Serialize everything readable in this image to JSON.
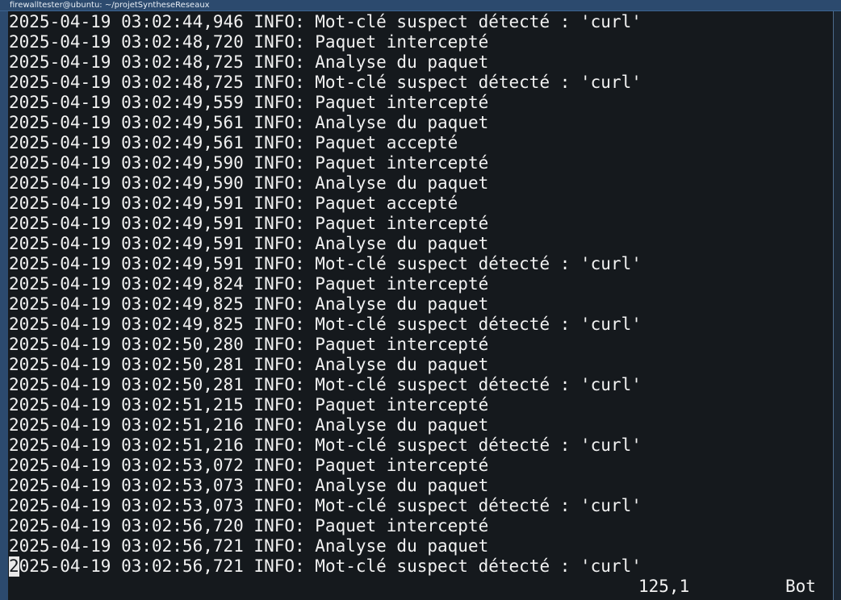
{
  "window": {
    "title": "firewalltester@ubuntu: ~/projetSyntheseReseaux"
  },
  "terminal": {
    "lines": [
      "2025-04-19 03:02:44,946 INFO: Mot-clé suspect détecté : 'curl'",
      "2025-04-19 03:02:48,720 INFO: Paquet intercepté",
      "2025-04-19 03:02:48,725 INFO: Analyse du paquet",
      "2025-04-19 03:02:48,725 INFO: Mot-clé suspect détecté : 'curl'",
      "2025-04-19 03:02:49,559 INFO: Paquet intercepté",
      "2025-04-19 03:02:49,561 INFO: Analyse du paquet",
      "2025-04-19 03:02:49,561 INFO: Paquet accepté",
      "2025-04-19 03:02:49,590 INFO: Paquet intercepté",
      "2025-04-19 03:02:49,590 INFO: Analyse du paquet",
      "2025-04-19 03:02:49,591 INFO: Paquet accepté",
      "2025-04-19 03:02:49,591 INFO: Paquet intercepté",
      "2025-04-19 03:02:49,591 INFO: Analyse du paquet",
      "2025-04-19 03:02:49,591 INFO: Mot-clé suspect détecté : 'curl'",
      "2025-04-19 03:02:49,824 INFO: Paquet intercepté",
      "2025-04-19 03:02:49,825 INFO: Analyse du paquet",
      "2025-04-19 03:02:49,825 INFO: Mot-clé suspect détecté : 'curl'",
      "2025-04-19 03:02:50,280 INFO: Paquet intercepté",
      "2025-04-19 03:02:50,281 INFO: Analyse du paquet",
      "2025-04-19 03:02:50,281 INFO: Mot-clé suspect détecté : 'curl'",
      "2025-04-19 03:02:51,215 INFO: Paquet intercepté",
      "2025-04-19 03:02:51,216 INFO: Analyse du paquet",
      "2025-04-19 03:02:51,216 INFO: Mot-clé suspect détecté : 'curl'",
      "2025-04-19 03:02:53,072 INFO: Paquet intercepté",
      "2025-04-19 03:02:53,073 INFO: Analyse du paquet",
      "2025-04-19 03:02:53,073 INFO: Mot-clé suspect détecté : 'curl'",
      "2025-04-19 03:02:56,720 INFO: Paquet intercepté",
      "2025-04-19 03:02:56,721 INFO: Analyse du paquet"
    ],
    "cursor_line": {
      "cursor_char": "2",
      "rest": "025-04-19 03:02:56,721 INFO: Mot-clé suspect détecté : 'curl'"
    },
    "status": {
      "position": "125,1",
      "scroll": "Bot"
    }
  },
  "colors": {
    "background": "#15191d",
    "text": "#f2f2f2",
    "titlebar": "#2c4a6e"
  }
}
